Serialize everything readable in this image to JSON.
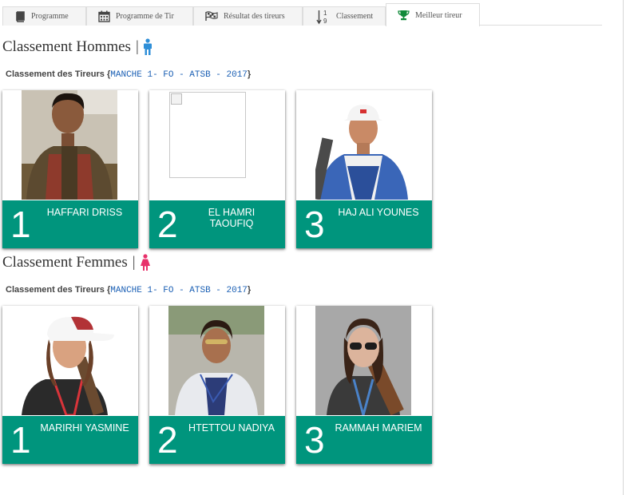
{
  "tabs": [
    {
      "label": "Programme",
      "icon": "book-icon"
    },
    {
      "label": "Programme de Tir",
      "icon": "calendar-icon"
    },
    {
      "label": "Résultat des tireurs",
      "icon": "flag-checkered-icon"
    },
    {
      "label": "Classement",
      "icon": "sort-numeric-icon"
    },
    {
      "label": "Meilleur tireur",
      "icon": "trophy-icon",
      "active": true
    }
  ],
  "men": {
    "title": "Classement Hommes",
    "separator": "|",
    "icon": "male-icon",
    "subtitle": "Classement des Tireurs",
    "brace_open": "{",
    "event": "MANCHE 1- FO - ATSB - 2017",
    "brace_close": "}",
    "podium": [
      {
        "rank": "1",
        "name": "HAFFARI DRISS"
      },
      {
        "rank": "2",
        "name": "EL HAMRI TAOUFIQ"
      },
      {
        "rank": "3",
        "name": "HAJ ALI YOUNES"
      }
    ]
  },
  "women": {
    "title": "Classement Femmes",
    "separator": "|",
    "icon": "female-icon",
    "subtitle": "Classement des Tireurs",
    "brace_open": "{",
    "event": "MANCHE 1- FO - ATSB - 2017",
    "brace_close": "}",
    "podium": [
      {
        "rank": "1",
        "name": "MARIRHI YASMINE"
      },
      {
        "rank": "2",
        "name": "HTETTOU NADIYA"
      },
      {
        "rank": "3",
        "name": "RAMMAH MARIEM"
      }
    ]
  },
  "colors": {
    "band": "#00957d",
    "male_icon": "#2f8fd8",
    "female_icon": "#e8316b",
    "trophy": "#118a3a"
  }
}
